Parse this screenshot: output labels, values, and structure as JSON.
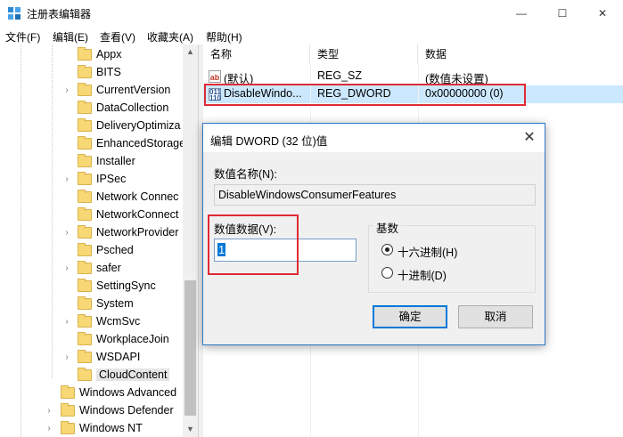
{
  "window": {
    "title": "注册表编辑器",
    "minimize": "—",
    "maximize": "☐",
    "close": "✕"
  },
  "menu": [
    "文件(F)",
    "编辑(E)",
    "查看(V)",
    "收藏夹(A)",
    "帮助(H)"
  ],
  "tree": {
    "items": [
      {
        "label": "Appx",
        "expander": ""
      },
      {
        "label": "BITS",
        "expander": ""
      },
      {
        "label": "CurrentVersion",
        "expander": "›"
      },
      {
        "label": "DataCollection",
        "expander": ""
      },
      {
        "label": "DeliveryOptimiza",
        "expander": ""
      },
      {
        "label": "EnhancedStorage",
        "expander": ""
      },
      {
        "label": "Installer",
        "expander": ""
      },
      {
        "label": "IPSec",
        "expander": "›"
      },
      {
        "label": "Network Connec",
        "expander": ""
      },
      {
        "label": "NetworkConnect",
        "expander": ""
      },
      {
        "label": "NetworkProvider",
        "expander": "›"
      },
      {
        "label": "Psched",
        "expander": ""
      },
      {
        "label": "safer",
        "expander": "›"
      },
      {
        "label": "SettingSync",
        "expander": ""
      },
      {
        "label": "System",
        "expander": ""
      },
      {
        "label": "WcmSvc",
        "expander": "›"
      },
      {
        "label": "WorkplaceJoin",
        "expander": ""
      },
      {
        "label": "WSDAPI",
        "expander": "›"
      },
      {
        "label": "CloudContent",
        "expander": ""
      },
      {
        "label": "Windows Advanced",
        "expander": ""
      },
      {
        "label": "Windows Defender",
        "expander": "›"
      },
      {
        "label": "Windows NT",
        "expander": "›"
      }
    ],
    "selected": "CloudContent"
  },
  "list": {
    "columns": [
      "名称",
      "类型",
      "数据"
    ],
    "rows": [
      {
        "icon": "string-value-icon",
        "name": "(默认)",
        "type": "REG_SZ",
        "data": "(数值未设置)"
      },
      {
        "icon": "dword-value-icon",
        "name": "DisableWindo...",
        "type": "REG_DWORD",
        "data": "0x00000000 (0)"
      }
    ]
  },
  "dialog": {
    "title": "编辑 DWORD (32 位)值",
    "close": "✕",
    "name_label": "数值名称(N):",
    "name_value": "DisableWindowsConsumerFeatures",
    "data_label": "数值数据(V):",
    "data_value": "1",
    "base_label": "基数",
    "base_options": [
      {
        "label": "十六进制(H)",
        "checked": true
      },
      {
        "label": "十进制(D)",
        "checked": false
      }
    ],
    "ok": "确定",
    "cancel": "取消"
  },
  "colors": {
    "highlight_box": "#e02a36",
    "selection": "#0078d7",
    "folder": "#f8d775"
  }
}
